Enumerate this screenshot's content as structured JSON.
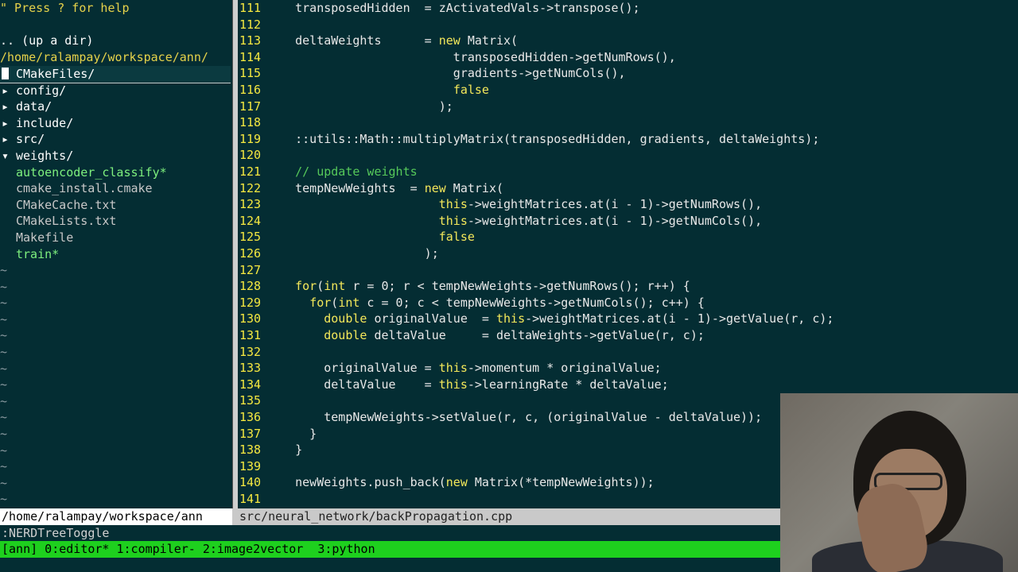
{
  "tree": {
    "help": "\" Press ? for help",
    "up_dir": ".. (up a dir)",
    "root_path": "/home/ralampay/workspace/ann/",
    "items": [
      {
        "arrow": "▸",
        "name": "CMakeFiles/",
        "kind": "dir"
      },
      {
        "arrow": "▸",
        "name": "config/",
        "kind": "dir"
      },
      {
        "arrow": "▸",
        "name": "data/",
        "kind": "dir"
      },
      {
        "arrow": "▸",
        "name": "include/",
        "kind": "dir"
      },
      {
        "arrow": "▸",
        "name": "src/",
        "kind": "dir"
      },
      {
        "arrow": "▾",
        "name": "weights/",
        "kind": "dir"
      },
      {
        "arrow": "",
        "name": "autoencoder_classify*",
        "kind": "exe"
      },
      {
        "arrow": "",
        "name": "cmake_install.cmake",
        "kind": "file"
      },
      {
        "arrow": "",
        "name": "CMakeCache.txt",
        "kind": "file"
      },
      {
        "arrow": "",
        "name": "CMakeLists.txt",
        "kind": "file"
      },
      {
        "arrow": "",
        "name": "Makefile",
        "kind": "file"
      },
      {
        "arrow": "",
        "name": "train*",
        "kind": "exe"
      }
    ],
    "tilde": "~"
  },
  "code_lines": [
    {
      "n": "111",
      "segs": [
        [
          "c",
          "    transposedHidden  = zActivatedVals->transpose();"
        ]
      ]
    },
    {
      "n": "112",
      "segs": [
        [
          "c",
          ""
        ]
      ]
    },
    {
      "n": "113",
      "segs": [
        [
          "c",
          "    deltaWeights      = "
        ],
        [
          "k",
          "new"
        ],
        [
          "c",
          " Matrix("
        ]
      ]
    },
    {
      "n": "114",
      "segs": [
        [
          "c",
          "                          transposedHidden->getNumRows(),"
        ]
      ]
    },
    {
      "n": "115",
      "segs": [
        [
          "c",
          "                          gradients->getNumCols(),"
        ]
      ]
    },
    {
      "n": "116",
      "segs": [
        [
          "c",
          "                          "
        ],
        [
          "k",
          "false"
        ]
      ]
    },
    {
      "n": "117",
      "segs": [
        [
          "c",
          "                        );"
        ]
      ]
    },
    {
      "n": "118",
      "segs": [
        [
          "c",
          ""
        ]
      ]
    },
    {
      "n": "119",
      "segs": [
        [
          "c",
          "    ::utils::Math::multiplyMatrix(transposedHidden, gradients, deltaWeights);"
        ]
      ]
    },
    {
      "n": "120",
      "segs": [
        [
          "c",
          ""
        ]
      ]
    },
    {
      "n": "121",
      "segs": [
        [
          "m",
          "    // update weights"
        ]
      ]
    },
    {
      "n": "122",
      "segs": [
        [
          "c",
          "    tempNewWeights  = "
        ],
        [
          "k",
          "new"
        ],
        [
          "c",
          " Matrix("
        ]
      ]
    },
    {
      "n": "123",
      "segs": [
        [
          "c",
          "                        "
        ],
        [
          "k",
          "this"
        ],
        [
          "c",
          "->weightMatrices.at(i - 1)->getNumRows(),"
        ]
      ]
    },
    {
      "n": "124",
      "segs": [
        [
          "c",
          "                        "
        ],
        [
          "k",
          "this"
        ],
        [
          "c",
          "->weightMatrices.at(i - 1)->getNumCols(),"
        ]
      ]
    },
    {
      "n": "125",
      "segs": [
        [
          "c",
          "                        "
        ],
        [
          "k",
          "false"
        ]
      ]
    },
    {
      "n": "126",
      "segs": [
        [
          "c",
          "                      );"
        ]
      ]
    },
    {
      "n": "127",
      "segs": [
        [
          "c",
          ""
        ]
      ]
    },
    {
      "n": "128",
      "segs": [
        [
          "c",
          "    "
        ],
        [
          "k",
          "for"
        ],
        [
          "c",
          "("
        ],
        [
          "k",
          "int"
        ],
        [
          "c",
          " r = 0; r < tempNewWeights->getNumRows(); r++) {"
        ]
      ]
    },
    {
      "n": "129",
      "segs": [
        [
          "c",
          "      "
        ],
        [
          "k",
          "for"
        ],
        [
          "c",
          "("
        ],
        [
          "k",
          "int"
        ],
        [
          "c",
          " c = 0; c < tempNewWeights->getNumCols(); c++) {"
        ]
      ]
    },
    {
      "n": "130",
      "segs": [
        [
          "c",
          "        "
        ],
        [
          "k",
          "double"
        ],
        [
          "c",
          " originalValue  = "
        ],
        [
          "k",
          "this"
        ],
        [
          "c",
          "->weightMatrices.at(i - 1)->getValue(r, c);"
        ]
      ]
    },
    {
      "n": "131",
      "segs": [
        [
          "c",
          "        "
        ],
        [
          "k",
          "double"
        ],
        [
          "c",
          " deltaValue     = deltaWeights->getValue(r, c);"
        ]
      ]
    },
    {
      "n": "132",
      "segs": [
        [
          "c",
          ""
        ]
      ]
    },
    {
      "n": "133",
      "segs": [
        [
          "c",
          "        originalValue = "
        ],
        [
          "k",
          "this"
        ],
        [
          "c",
          "->momentum * originalValue;"
        ]
      ]
    },
    {
      "n": "134",
      "segs": [
        [
          "c",
          "        deltaValue    = "
        ],
        [
          "k",
          "this"
        ],
        [
          "c",
          "->learningRate * deltaValue;"
        ]
      ]
    },
    {
      "n": "135",
      "segs": [
        [
          "c",
          ""
        ]
      ]
    },
    {
      "n": "136",
      "segs": [
        [
          "c",
          "        tempNewWeights->setValue(r, c, (originalValue - deltaValue));"
        ]
      ]
    },
    {
      "n": "137",
      "segs": [
        [
          "c",
          "      }"
        ]
      ]
    },
    {
      "n": "138",
      "segs": [
        [
          "c",
          "    }"
        ]
      ]
    },
    {
      "n": "139",
      "segs": [
        [
          "c",
          ""
        ]
      ]
    },
    {
      "n": "140",
      "segs": [
        [
          "c",
          "    newWeights.push_back("
        ],
        [
          "k",
          "new"
        ],
        [
          "c",
          " Matrix(*tempNewWeights));"
        ]
      ]
    },
    {
      "n": "141",
      "segs": [
        [
          "c",
          ""
        ]
      ]
    }
  ],
  "status": {
    "left": "/home/ralampay/workspace/ann",
    "right": "src/neural_network/backPropagation.cpp"
  },
  "cmdline": ":NERDTreeToggle",
  "tmux": "[ann] 0:editor* 1:compiler- 2:image2vector  3:python",
  "colors": {
    "background": "#042d33",
    "line_number": "#f5e840",
    "keyword": "#f4e85a",
    "comment": "#56c95a",
    "tmux_bar": "#1ed01e"
  }
}
